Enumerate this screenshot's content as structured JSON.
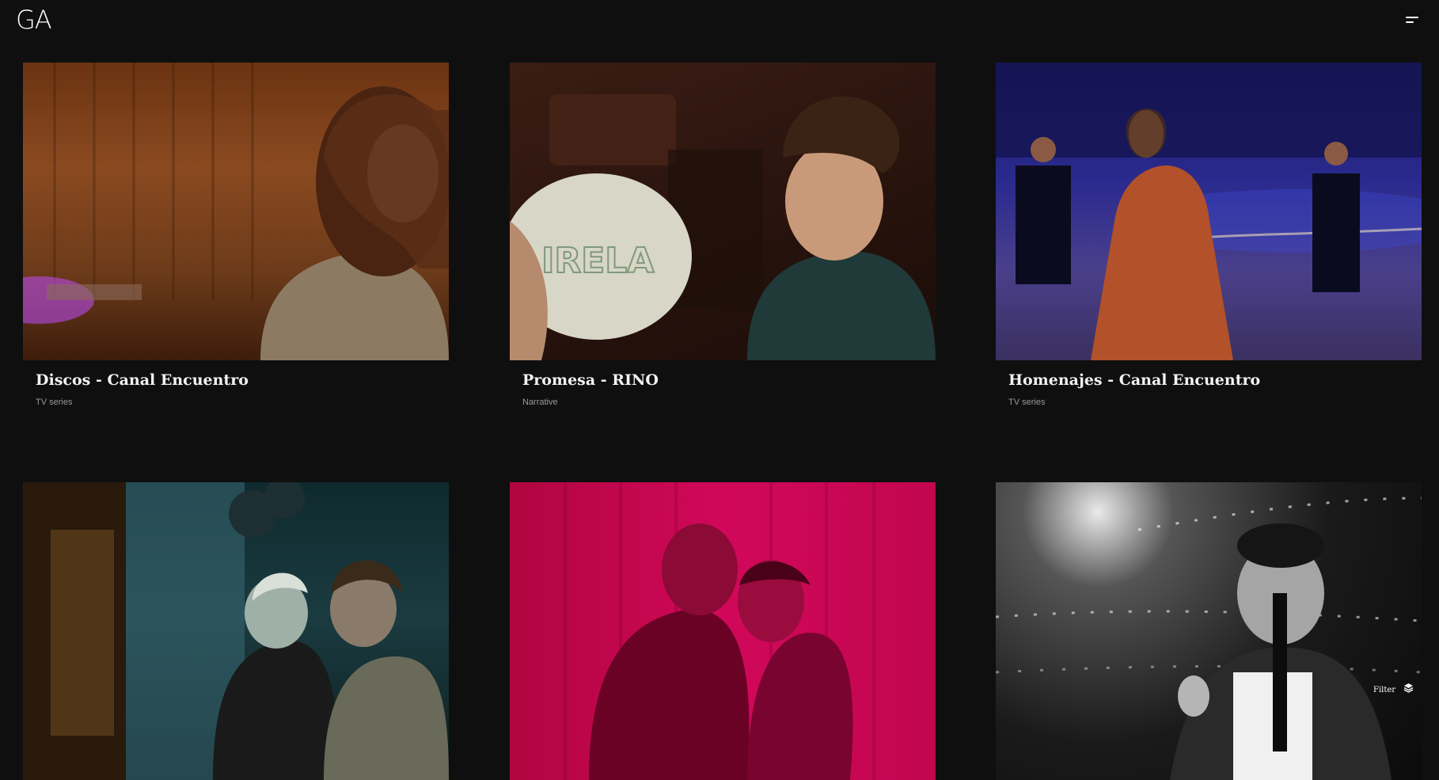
{
  "header": {
    "logo": "GA"
  },
  "projects": [
    {
      "title": "Discos - Canal Encuentro",
      "category": "TV series"
    },
    {
      "title": "Promesa - RINO",
      "category": "Narrative"
    },
    {
      "title": "Homenajes - Canal Encuentro",
      "category": "TV series"
    },
    {
      "title": "",
      "category": ""
    },
    {
      "title": "",
      "category": ""
    },
    {
      "title": "",
      "category": ""
    }
  ],
  "filter": {
    "label": "Filter",
    "icon": "layers-icon"
  },
  "colors": {
    "background": "#0f0f0f",
    "text": "#ffffff",
    "muted": "#9a9a9a"
  }
}
